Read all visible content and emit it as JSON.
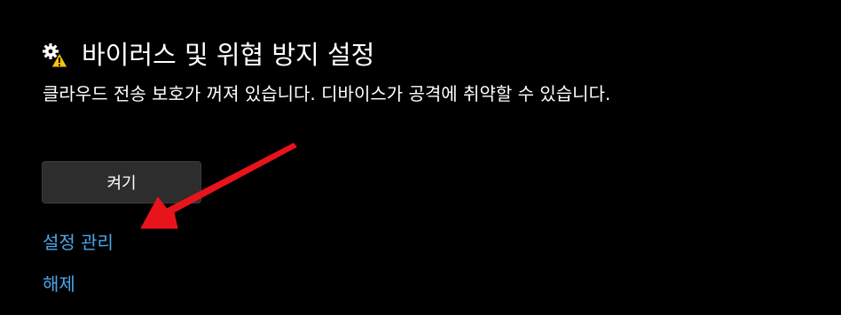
{
  "header": {
    "icon": "shield-warning-icon",
    "title": "바이러스 및 위협 방지 설정"
  },
  "description": "클라우드 전송 보호가 꺼져 있습니다. 디바이스가 공격에 취약할 수 있습니다.",
  "actions": {
    "turn_on_label": "켜기",
    "manage_settings_label": "설정 관리",
    "dismiss_label": "해제"
  },
  "annotation": {
    "arrow_icon": "red-arrow-icon",
    "arrow_color": "#e8141b"
  },
  "colors": {
    "background": "#000000",
    "link": "#4ca7e8",
    "button": "#2d2d2d",
    "warning": "#f2c40f"
  }
}
